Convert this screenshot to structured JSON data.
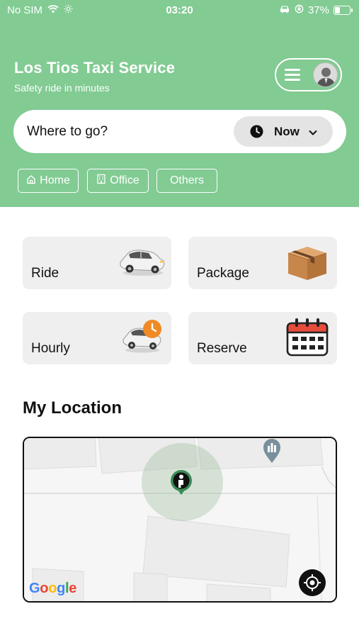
{
  "status_bar": {
    "carrier": "No SIM",
    "time": "03:20",
    "battery_text": "37%",
    "battery_level": 0.37
  },
  "header": {
    "title": "Los Tios Taxi Service",
    "subtitle": "Safety ride in minutes",
    "menu_icon": "hamburger-icon",
    "avatar_icon": "user-avatar-icon"
  },
  "search": {
    "placeholder": "Where to go?",
    "time_value": "Now",
    "time_icon": "clock-icon",
    "dropdown_icon": "chevron-down-icon"
  },
  "quick_places": [
    {
      "label": "Home",
      "icon": "home-icon"
    },
    {
      "label": "Office",
      "icon": "building-icon"
    },
    {
      "label": "Others",
      "icon": ""
    }
  ],
  "services": [
    {
      "label": "Ride",
      "icon": "car-icon"
    },
    {
      "label": "Package",
      "icon": "package-box-icon"
    },
    {
      "label": "Hourly",
      "icon": "car-clock-icon"
    },
    {
      "label": "Reserve",
      "icon": "calendar-icon"
    }
  ],
  "location": {
    "title": "My Location",
    "map_attribution": "Google",
    "user_marker_icon": "user-location-pin-icon",
    "poi_icon": "map-pin-icon",
    "locate_icon": "locate-crosshair-icon"
  },
  "colors": {
    "brand_green": "#82cb93",
    "card_bg": "#efefef",
    "accent_orange": "#f08a24",
    "calendar_red": "#e74c3c"
  }
}
